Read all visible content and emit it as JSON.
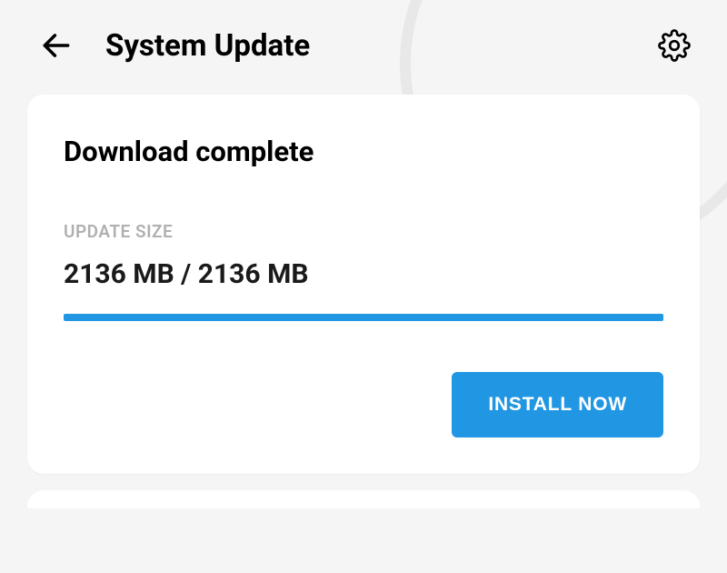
{
  "header": {
    "title": "System Update"
  },
  "card": {
    "heading": "Download complete",
    "size_label": "UPDATE SIZE",
    "size_value": "2136 MB / 2136 MB",
    "install_label": "INSTALL NOW"
  },
  "colors": {
    "accent": "#2196e3"
  }
}
